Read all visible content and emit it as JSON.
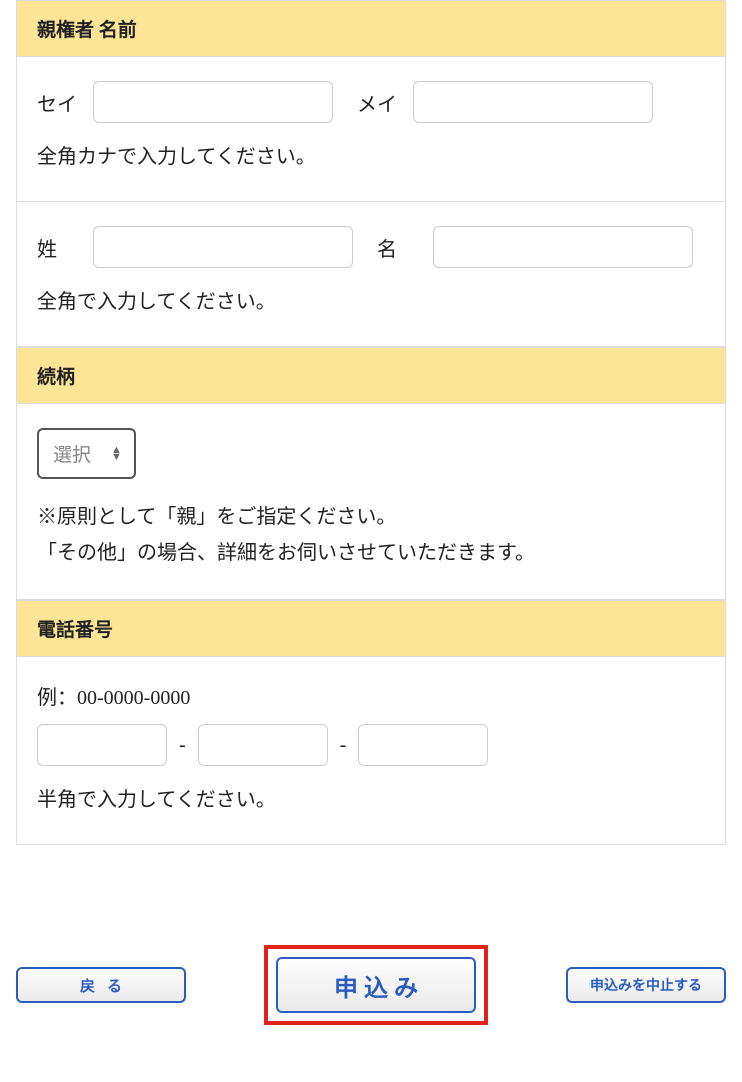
{
  "sections": {
    "guardianName": {
      "header": "親権者 名前",
      "kanaSeiLabel": "セイ",
      "kanaMeiLabel": "メイ",
      "kanaSeiValue": "",
      "kanaMeiValue": "",
      "kanaHint": "全角カナで入力してください。",
      "seiLabel": "姓",
      "meiLabel": "名",
      "seiValue": "",
      "meiValue": "",
      "nameHint": "全角で入力してください。"
    },
    "relationship": {
      "header": "続柄",
      "selectPlaceholder": "選択",
      "note1": "※原則として「親」をご指定ください。",
      "note2": "「その他」の場合、詳細をお伺いさせていただきます。"
    },
    "phone": {
      "header": "電話番号",
      "example": "例：00-0000-0000",
      "p1": "",
      "p2": "",
      "p3": "",
      "dash": "-",
      "hint": "半角で入力してください。"
    }
  },
  "buttons": {
    "back": "戻る",
    "apply": "申込み",
    "cancel": "申込みを中止する"
  }
}
